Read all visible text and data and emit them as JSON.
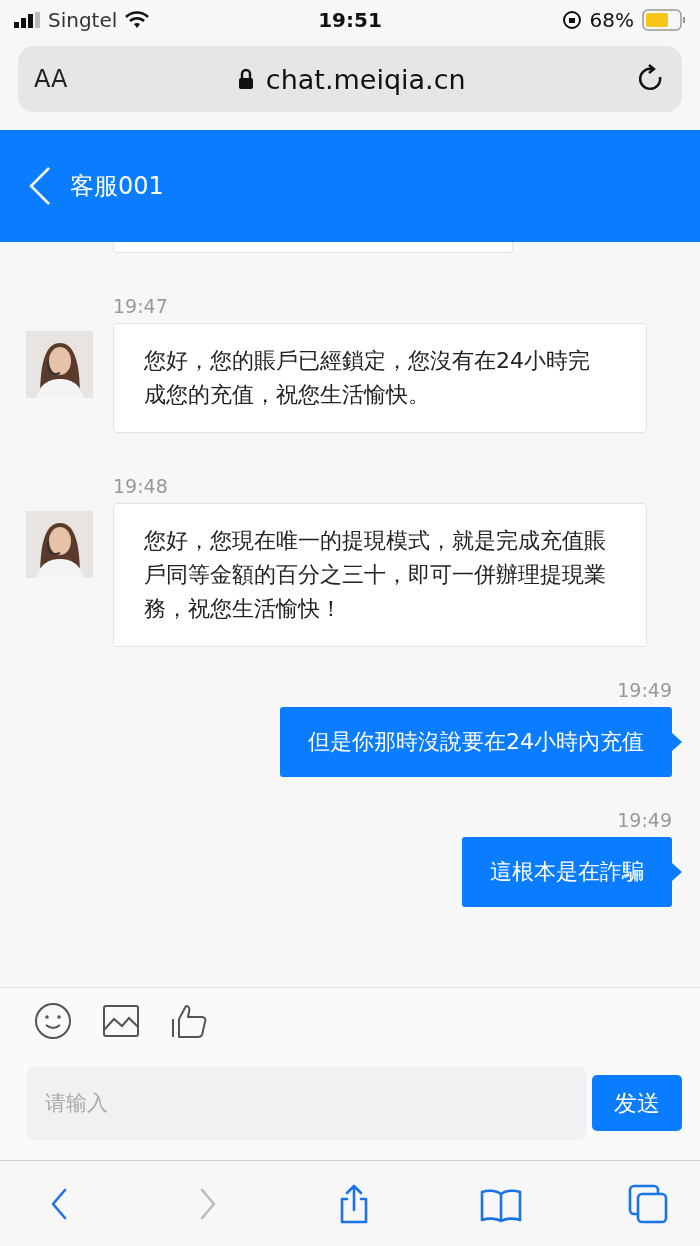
{
  "status_bar": {
    "carrier": "Singtel",
    "time": "19:51",
    "battery": "68%"
  },
  "address_bar": {
    "text_size": "AA",
    "url": "chat.meiqia.cn"
  },
  "header": {
    "title": "客服001"
  },
  "messages": [
    {
      "kind": "agent",
      "time": "19:47",
      "text": "您好，您的賬戶已經鎖定，您沒有在24小時完成您的充值，祝您生活愉快。"
    },
    {
      "kind": "agent",
      "time": "19:48",
      "text": "您好，您現在唯一的提現模式，就是完成充值賬戶同等金額的百分之三十，即可一併辦理提現業務，祝您生活愉快！"
    },
    {
      "kind": "user",
      "time": "19:49",
      "text": "但是你那時沒說要在24小時內充值"
    },
    {
      "kind": "user",
      "time": "19:49",
      "text": "這根本是在詐騙"
    }
  ],
  "composer": {
    "placeholder": "请输入",
    "send": "发送"
  },
  "browser_toolbar": [
    {
      "kind": "back",
      "disabled": false
    },
    {
      "kind": "forward",
      "disabled": true
    },
    {
      "kind": "share",
      "disabled": false
    },
    {
      "kind": "bookmarks",
      "disabled": false
    },
    {
      "kind": "tabs",
      "disabled": false
    }
  ]
}
